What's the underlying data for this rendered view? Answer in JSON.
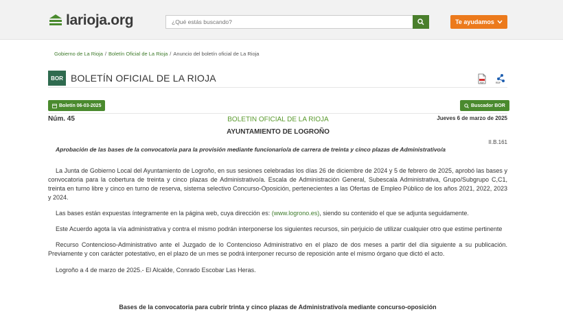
{
  "header": {
    "logo_text": "larioja.org",
    "search_placeholder": "¿Qué estás buscando?",
    "help_label": "Te ayudamos"
  },
  "breadcrumb": {
    "items": [
      "Gobierno de La Rioja",
      "Boletín Oficial de La Rioja",
      "Anuncio del boletín oficial de La Rioja"
    ]
  },
  "bor": {
    "logo_text": "BOR",
    "title": "BOLETÍN OFICIAL DE LA RIOJA",
    "pdf_label": "PDF",
    "rdf_label": "RDF"
  },
  "toolbar": {
    "boletin_label": "Boletín 06-03-2025",
    "buscador_label": "Buscador BOR"
  },
  "doc": {
    "num": "Núm. 45",
    "boletin": "BOLETIN OFICIAL DE LA RIOJA",
    "fecha": "Jueves 6 de marzo de 2025",
    "ayuntamiento": "AYUNTAMIENTO DE LOGROÑO",
    "code": "II.B.161",
    "subtitle": "Aprobación de las bases de la convocatoria para la provisión mediante funcionario/a de carrera de treinta y cinco plazas de Administrativo/a",
    "p1": "La Junta de Gobierno Local del Ayuntamiento de Logroño, en sus sesiones celebradas los días 26 de diciembre de 2024 y 5 de febrero de 2025, aprobó las bases y convocatoria para la cobertura de treinta y cinco plazas de Administrativo/a. Escala de Administración General, Subescala Administrativa, Grupo/Subgrupo C,C1, treinta en turno libre y cinco en turno de reserva, sistema selectivo Concurso-Oposición, pertenecientes a las Ofertas de Empleo Público de los años 2021, 2022, 2023 y 2024.",
    "p2_before": "Las bases están expuestas íntegramente en la página web, cuya dirección es: ",
    "p2_link": "(www.logrono.es)",
    "p2_after": ", siendo su contenido el que se adjunta seguidamente.",
    "p3": "Este Acuerdo agota la vía administrativa y contra el mismo podrán interponerse los siguientes recursos, sin perjuicio de utilizar cualquier otro que estime pertinente",
    "p4": "Recurso Contencioso-Administrativo ante el Juzgado de lo Contencioso Administrativo en el plazo de dos meses a partir del día siguiente a su publicación. Previamente y con carácter potestativo, en el plazo de un mes se podrá interponer recurso de reposición ante el mismo órgano que dictó el acto.",
    "p5": "Logroño a 4 de marzo de 2025.- El Alcalde, Conrado Escobar Las Heras.",
    "bases_title": "Bases de la convocatoria para cubrir trinta y cinco plazas de Administrativo/a mediante concurso-oposición"
  },
  "colors": {
    "brand_green": "#4a8a2e",
    "orange": "#ec7a1c",
    "bor_green": "#2f6b4f"
  }
}
